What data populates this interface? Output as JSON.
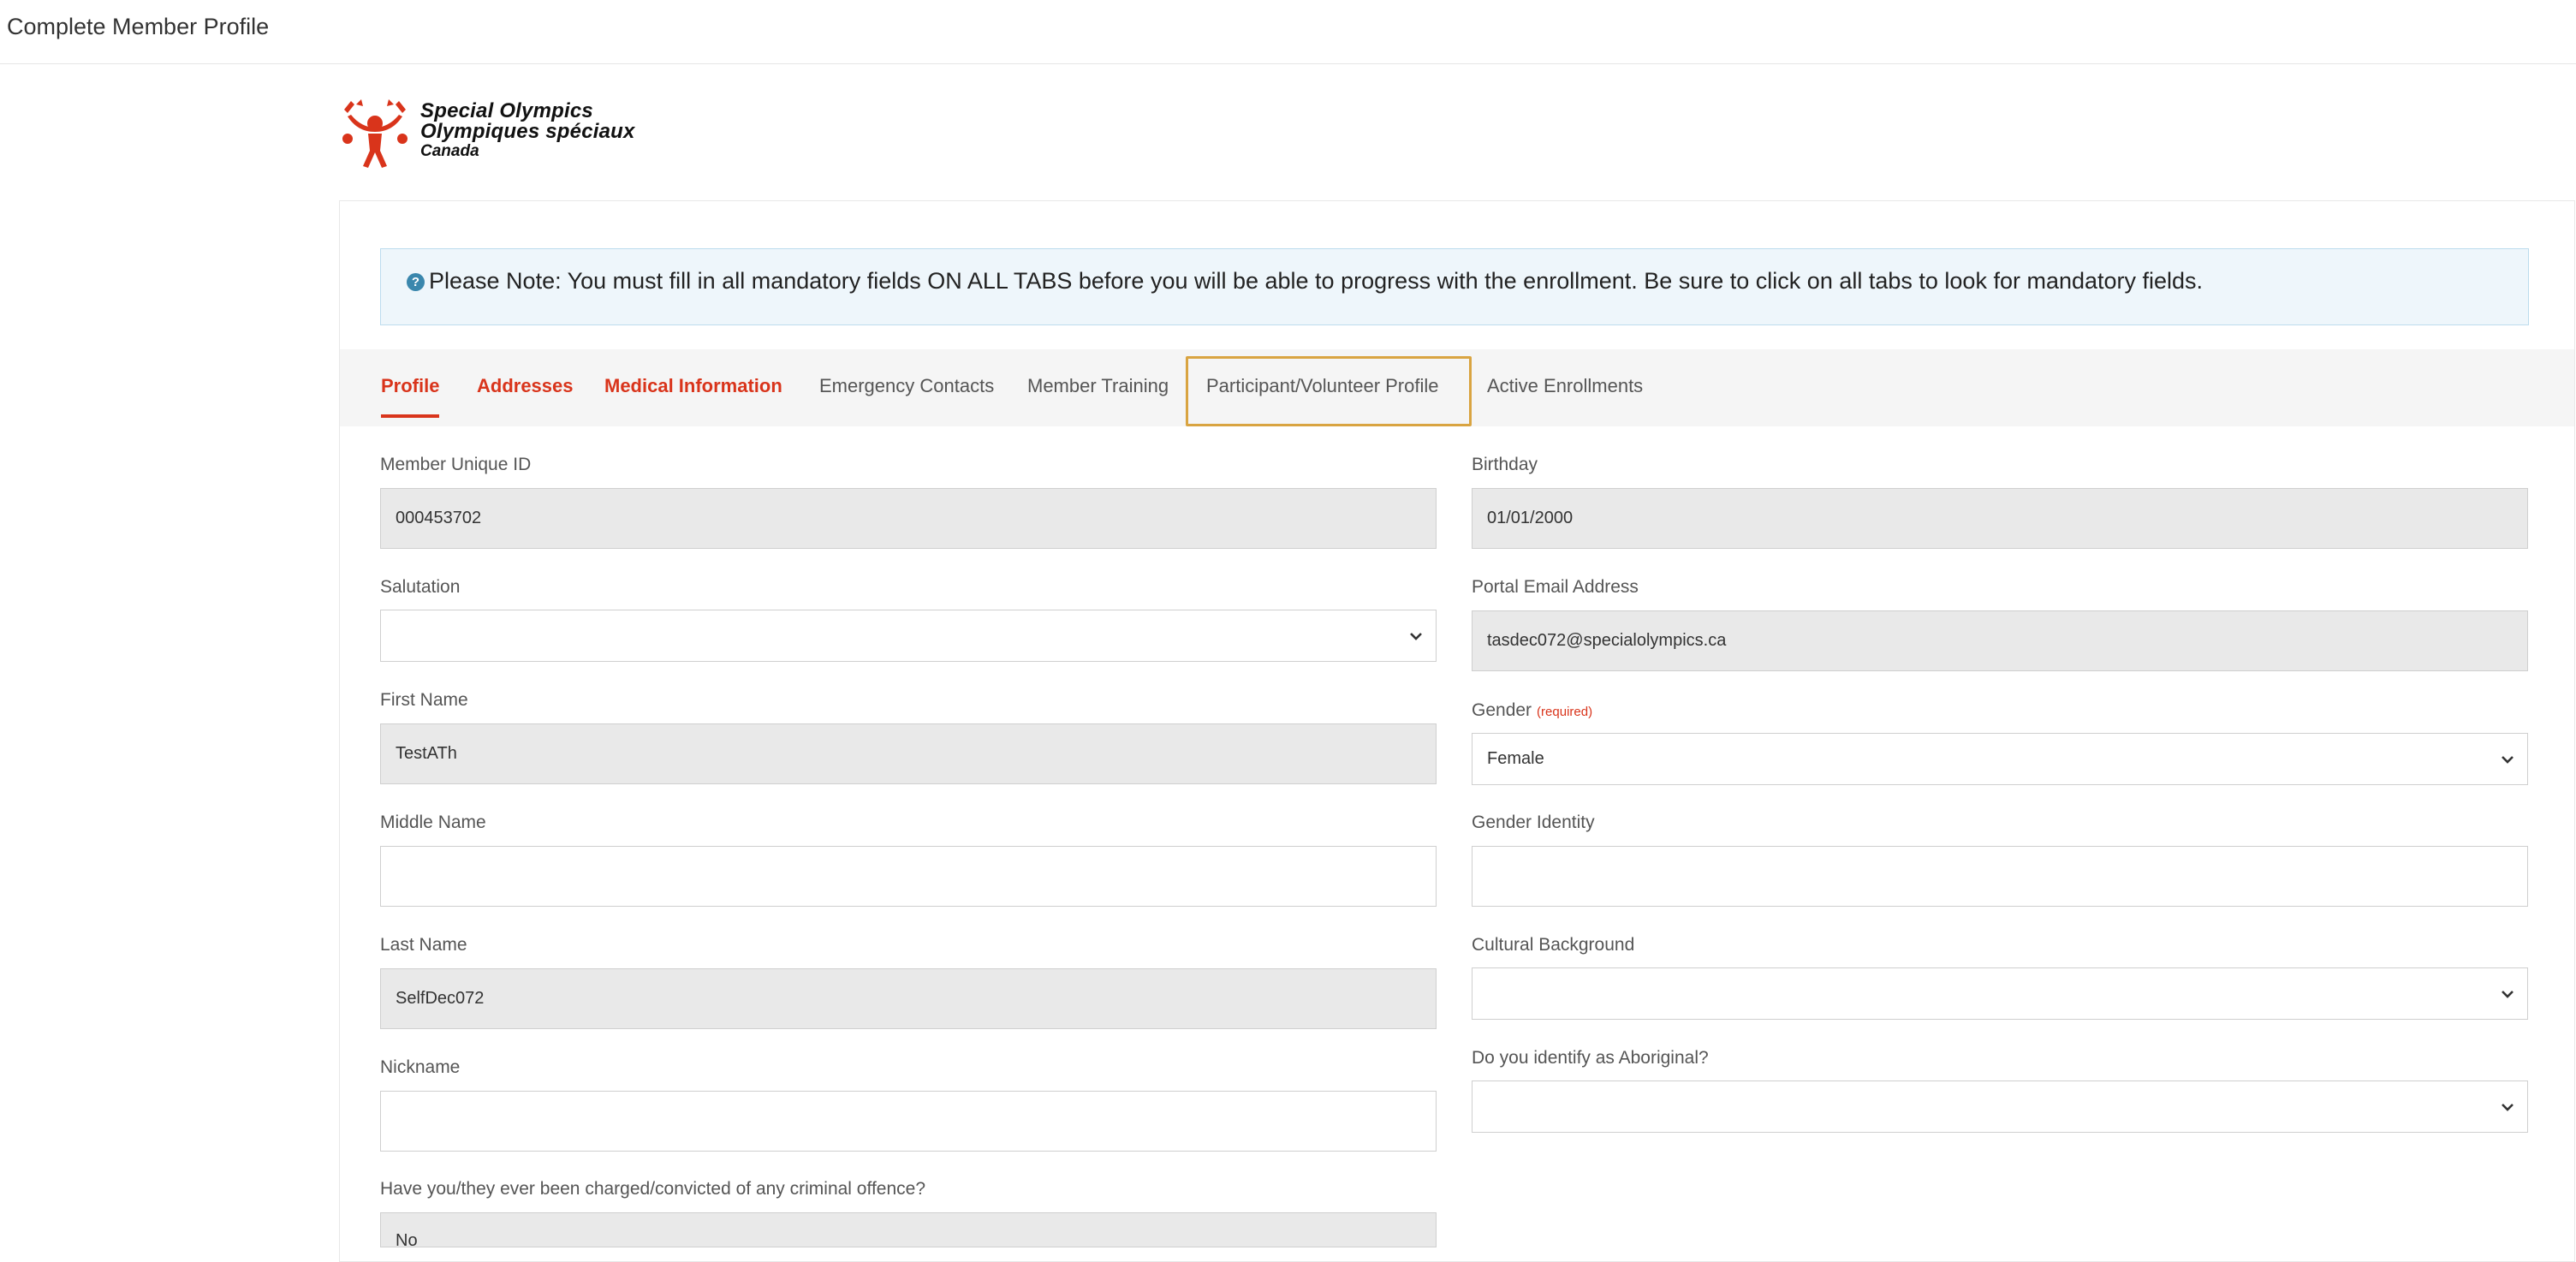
{
  "window": {
    "title": "Complete Member Profile"
  },
  "logo": {
    "line1": "Special Olympics",
    "line2": "Olympiques spéciaux",
    "line3": "Canada",
    "color": "#d9341b"
  },
  "notice": {
    "icon": "question-circle-icon",
    "text": "Please Note: You must fill in all mandatory fields ON ALL TABS before you will be able to progress with the enrollment. Be sure to click on all tabs to look for mandatory fields."
  },
  "tabs": [
    {
      "label": "Profile",
      "required": true,
      "active": true
    },
    {
      "label": "Addresses",
      "required": true,
      "active": false
    },
    {
      "label": "Medical Information",
      "required": true,
      "active": false
    },
    {
      "label": "Emergency Contacts",
      "required": false,
      "active": false
    },
    {
      "label": "Member Training",
      "required": false,
      "active": false
    },
    {
      "label": "Participant/Volunteer Profile",
      "required": false,
      "active": false,
      "highlighted": true
    },
    {
      "label": "Active Enrollments",
      "required": false,
      "active": false
    }
  ],
  "form": {
    "left": {
      "member_id": {
        "label": "Member Unique ID",
        "value": "000453702"
      },
      "salutation": {
        "label": "Salutation",
        "value": ""
      },
      "first_name": {
        "label": "First Name",
        "value": "TestATh"
      },
      "middle_name": {
        "label": "Middle Name",
        "value": ""
      },
      "last_name": {
        "label": "Last Name",
        "value": "SelfDec072"
      },
      "nickname": {
        "label": "Nickname",
        "value": ""
      },
      "criminal": {
        "label": "Have you/they ever been charged/convicted of any criminal offence?",
        "value": "No"
      }
    },
    "right": {
      "birthday": {
        "label": "Birthday",
        "value": "01/01/2000"
      },
      "email": {
        "label": "Portal Email Address",
        "value": "tasdec072@specialolympics.ca"
      },
      "gender": {
        "label": "Gender",
        "required_tag": "(required)",
        "value": "Female"
      },
      "gender_identity": {
        "label": "Gender Identity",
        "value": ""
      },
      "cultural": {
        "label": "Cultural Background",
        "value": ""
      },
      "aboriginal": {
        "label": "Do you identify as Aboriginal?",
        "value": ""
      }
    }
  },
  "colors": {
    "accent": "#d9341b",
    "highlight": "#d9a441",
    "readonly_bg": "#e9e9e9",
    "notice_bg": "#eef6fb"
  }
}
